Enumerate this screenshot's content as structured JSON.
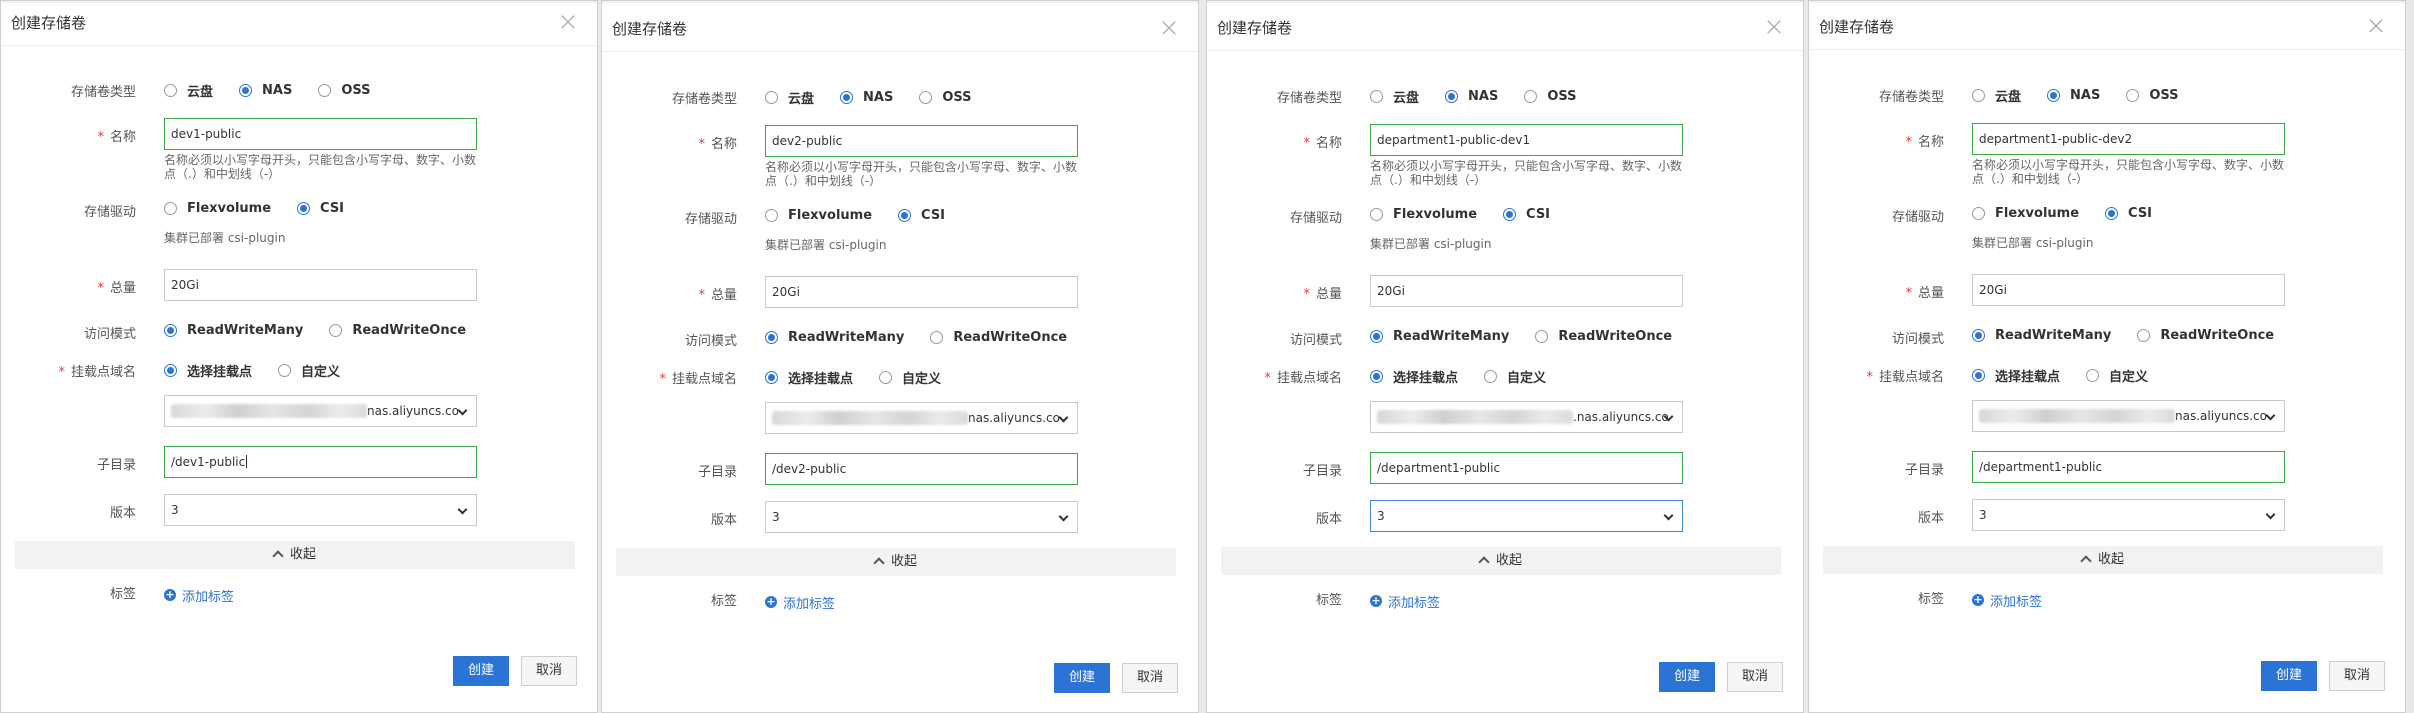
{
  "common": {
    "title": "创建存储卷",
    "close_glyph": "×",
    "labels": {
      "type": "存储卷类型",
      "name": "名称",
      "driver": "存储驱动",
      "capacity": "总量",
      "access_mode": "访问模式",
      "mount_domain": "挂载点域名",
      "subdir": "子目录",
      "version": "版本",
      "tags": "标签"
    },
    "required_mark": "*",
    "type_options": [
      "云盘",
      "NAS",
      "OSS"
    ],
    "type_selected": "NAS",
    "name_hint": "名称必须以小写字母开头，只能包含小写字母、数字、小数点（.）和中划线（-）",
    "driver_options": [
      "Flexvolume",
      "CSI"
    ],
    "driver_selected": "CSI",
    "driver_note": "集群已部署 csi-plugin",
    "capacity": "20Gi",
    "access_options": [
      "ReadWriteMany",
      "ReadWriteOnce"
    ],
    "access_selected": "ReadWriteMany",
    "mount_options": [
      "选择挂载点",
      "自定义"
    ],
    "mount_selected": "选择挂载点",
    "collapse_label": "收起",
    "add_tag_label": "添加标签",
    "create_label": "创建",
    "cancel_label": "取消",
    "icons": {
      "close": "close-icon",
      "chevron_down": "chevron-down-icon",
      "chevron_up": "chevron-up-icon",
      "add": "plus-circle-icon"
    },
    "colors": {
      "primary": "#2b73d5",
      "valid": "#3aa84a",
      "focus": "#3b86d6",
      "required": "#e4393c"
    }
  },
  "dialogs": [
    {
      "name": "dev1-public",
      "mount_suffix": "nas.aliyuncs.co",
      "subdir": "/dev1-public",
      "version": "3"
    },
    {
      "name": "dev2-public",
      "mount_suffix": "nas.aliyuncs.co",
      "subdir": "/dev2-public",
      "version": "3"
    },
    {
      "name": "department1-public-dev1",
      "mount_suffix": ".nas.aliyuncs.co",
      "subdir": "/department1-public",
      "version": "3"
    },
    {
      "name": "department1-public-dev2",
      "mount_suffix": "nas.aliyuncs.co",
      "subdir": "/department1-public",
      "version": "3"
    }
  ]
}
